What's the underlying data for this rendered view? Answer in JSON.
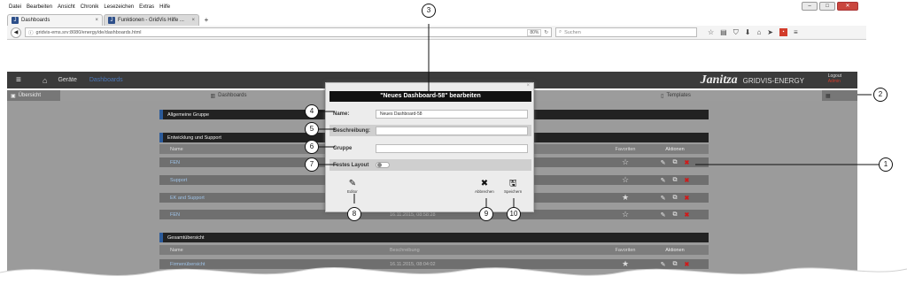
{
  "browser": {
    "menu": [
      "Datei",
      "Bearbeiten",
      "Ansicht",
      "Chronik",
      "Lesezeichen",
      "Extras",
      "Hilfe"
    ],
    "tabs": [
      {
        "label": "Dashboards",
        "active": true
      },
      {
        "label": "Funktionen - GridVis Hilfe ...",
        "active": false
      }
    ],
    "new_tab": "+",
    "url": "gridvis-ems.srv:8080/energy/de/dashboards.html",
    "zoom": "80%",
    "search_placeholder": "Suchen"
  },
  "app": {
    "nav_geraete": "Geräte",
    "nav_dashboards": "Dashboards",
    "brand": "Janitza",
    "brand_sub": "GRIDVIS-ENERGY",
    "logout": "Logout",
    "user": "Admin",
    "subtabs": {
      "overview": "Übersicht",
      "dashboards": "Dashboards",
      "templates": "Templates"
    }
  },
  "groups": [
    {
      "title": "Allgemeine Gruppe"
    },
    {
      "title": "Entwicklung und Support"
    },
    {
      "title": "Gesamtübersicht"
    }
  ],
  "table": {
    "col_name": "Name",
    "col_desc": "Beschreibung",
    "col_fav": "Favoriten",
    "col_actions": "Aktionen",
    "rows_group2": [
      {
        "name": "FEN",
        "desc": "",
        "fav": "☆"
      },
      {
        "name": "Support",
        "desc": "",
        "fav": "☆"
      },
      {
        "name": "EK and Support",
        "desc": "",
        "fav": "★"
      },
      {
        "name": "FEN",
        "desc": "16.11.2015, 08:58:28",
        "fav": "☆"
      }
    ],
    "rows_group3": [
      {
        "name": "Firmenübersicht",
        "desc": "16.11.2015, 08:04:02",
        "fav": "★"
      }
    ]
  },
  "modal": {
    "close": "×",
    "title": "\"Neues Dashboard-58\" bearbeiten",
    "name_label": "Name:",
    "name_value": "Neues Dashboard-58",
    "desc_label": "Beschreibung:",
    "desc_value": "",
    "group_label": "Gruppe",
    "group_value": "",
    "layout_label": "Festes Layout",
    "btn_editor": "Editor",
    "btn_cancel": "Abbrechen",
    "btn_save": "Speichern"
  },
  "callouts": [
    "1",
    "2",
    "3",
    "4",
    "5",
    "6",
    "7",
    "8",
    "9",
    "10"
  ]
}
